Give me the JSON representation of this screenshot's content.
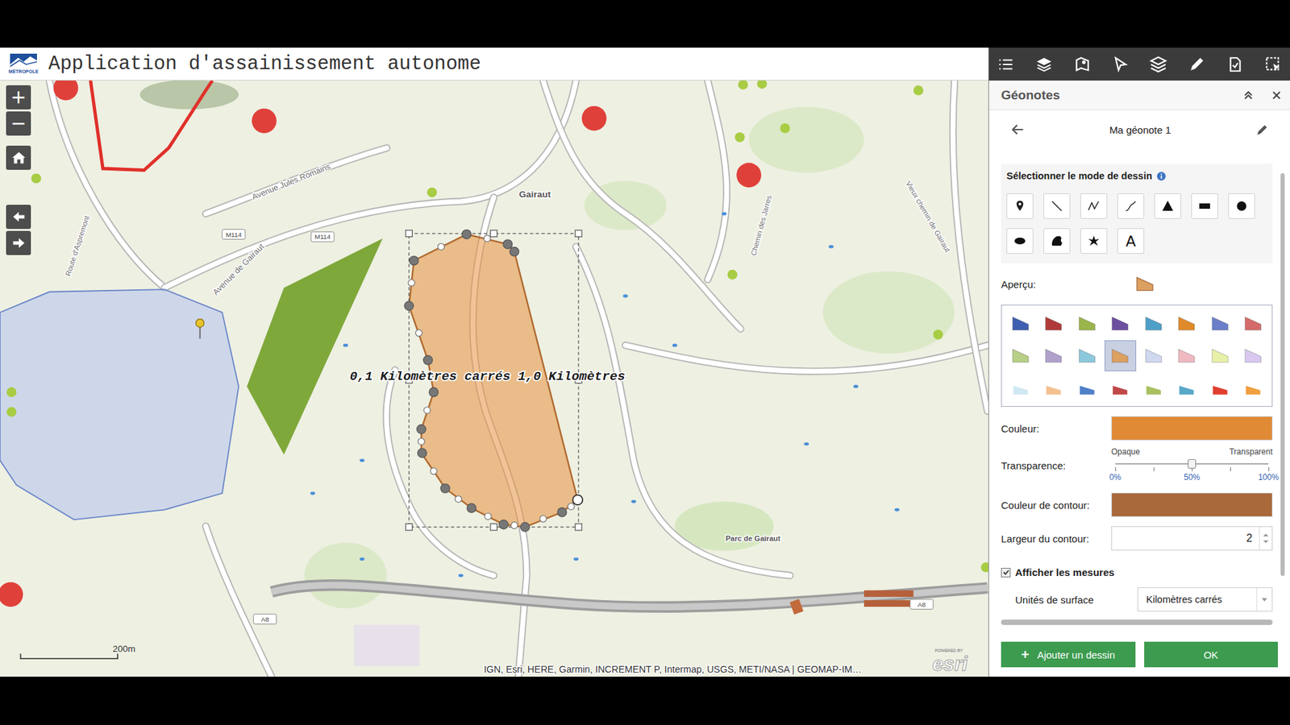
{
  "app": {
    "logo": "MÉTROPOLE",
    "title": "Application d'assainissement autonome"
  },
  "map_controls": {
    "zoom_in": "+",
    "zoom_out": "−"
  },
  "map": {
    "labels": [
      {
        "text": "Gairaut",
        "kind": "place"
      },
      {
        "text": "Avenue Jules Romains",
        "kind": "street"
      },
      {
        "text": "Route d'Aspremont",
        "kind": "street"
      },
      {
        "text": "M114",
        "kind": "shield"
      },
      {
        "text": "M114",
        "kind": "shield"
      },
      {
        "text": "Avenue de Gairaut",
        "kind": "street"
      },
      {
        "text": "Chemin des Jarres",
        "kind": "street"
      },
      {
        "text": "Vieux chemin de Gairaut",
        "kind": "street"
      },
      {
        "text": "Parc de Gairaut",
        "kind": "place"
      },
      {
        "text": "A8",
        "kind": "shield"
      },
      {
        "text": "A8",
        "kind": "shield"
      }
    ],
    "measure_label": "0,1 Kilomètres carrés 1,0 Kilomètres",
    "scale": "200m",
    "attribution": "IGN, Esri, HERE, Garmin, INCREMENT P, Intermap, USGS, METI/NASA | GEOMAP-IM…",
    "esri": {
      "powered": "POWERED BY",
      "brand": "esri"
    }
  },
  "panel": {
    "title": "Géonotes",
    "note_title": "Ma géonote 1",
    "draw_mode": {
      "heading": "Sélectionner le mode de dessin",
      "tools": [
        {
          "kind": "point",
          "selected": false
        },
        {
          "kind": "line",
          "selected": false
        },
        {
          "kind": "polyline",
          "selected": false
        },
        {
          "kind": "freehand-line",
          "selected": false
        },
        {
          "kind": "triangle",
          "selected": false
        },
        {
          "kind": "rectangle",
          "selected": false
        },
        {
          "kind": "circle",
          "selected": false
        },
        {
          "kind": "ellipse",
          "selected": false
        },
        {
          "kind": "freehand-polygon",
          "selected": false
        },
        {
          "kind": "star",
          "selected": false
        },
        {
          "kind": "text",
          "label": "A",
          "selected": false
        }
      ]
    },
    "preview": {
      "label": "Aperçu:",
      "color": "#dca060"
    },
    "swatches": [
      {
        "color": "#3f5fb0",
        "selected": false
      },
      {
        "color": "#b03a3a",
        "selected": false
      },
      {
        "color": "#9ab54a",
        "selected": false
      },
      {
        "color": "#6d4fa0",
        "selected": false
      },
      {
        "color": "#4fa0c8",
        "selected": false
      },
      {
        "color": "#e08a2a",
        "selected": false
      },
      {
        "color": "#6a7fc8",
        "selected": false
      },
      {
        "color": "#d46a6a",
        "selected": false
      },
      {
        "color": "#b8cf86",
        "selected": false
      },
      {
        "color": "#b0a0cc",
        "selected": false
      },
      {
        "color": "#8cc8dc",
        "selected": false
      },
      {
        "color": "#dca060",
        "selected": true
      },
      {
        "color": "#d0d8f0",
        "selected": false
      },
      {
        "color": "#f0b8c0",
        "selected": false
      },
      {
        "color": "#e8f0a8",
        "selected": false
      },
      {
        "color": "#d8c8f0",
        "selected": false
      },
      {
        "color": "#d0e8f4",
        "selected": false
      },
      {
        "color": "#f4c090",
        "selected": false
      },
      {
        "color": "#5080c8",
        "selected": false
      },
      {
        "color": "#c04848",
        "selected": false
      },
      {
        "color": "#a8c060",
        "selected": false
      },
      {
        "color": "#58a8c8",
        "selected": false
      },
      {
        "color": "#e04030",
        "selected": false
      },
      {
        "color": "#f0a040",
        "selected": false
      }
    ],
    "fill_color": {
      "label": "Couleur:",
      "color": "#e08a36"
    },
    "transparency": {
      "label": "Transparence:",
      "left": "Opaque",
      "right": "Transparent",
      "ticks": [
        "0%",
        "50%",
        "100%"
      ],
      "level": 0.5
    },
    "outline_color": {
      "label": "Couleur de contour:",
      "color": "#a9693a"
    },
    "outline_width": {
      "label": "Largeur du contour:",
      "value": "2"
    },
    "show_measures": {
      "label": "Afficher les mesures",
      "checked": true
    },
    "area_units": {
      "label": "Unités de surface",
      "value": "Kilomètres carrés"
    },
    "buttons": [
      {
        "label": "Ajouter un dessin",
        "icon": "+"
      },
      {
        "label": "OK"
      }
    ]
  }
}
